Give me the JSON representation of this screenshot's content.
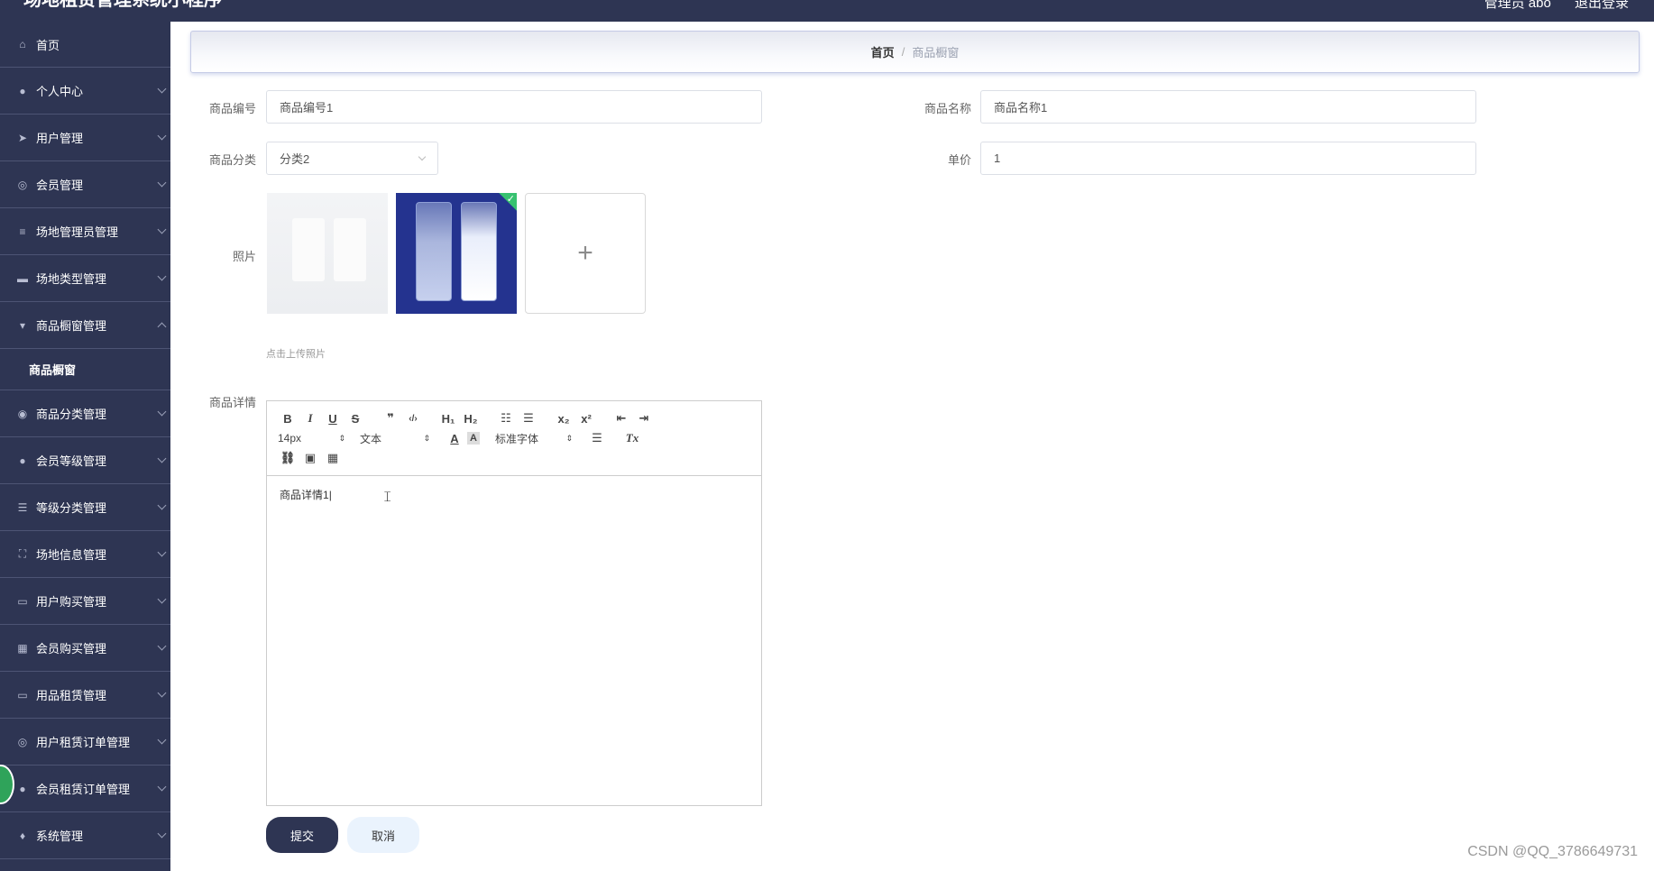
{
  "app": {
    "title": "场地租赁管理系统小程序"
  },
  "top_links": {
    "user": "管理员 abo",
    "logout": "退出登录"
  },
  "sidebar": {
    "items": [
      {
        "label": "首页",
        "icon": "home-icon",
        "chevron": false
      },
      {
        "label": "个人中心",
        "icon": "user-icon",
        "chevron": true
      },
      {
        "label": "用户管理",
        "icon": "send-icon",
        "chevron": true
      },
      {
        "label": "会员管理",
        "icon": "target-icon",
        "chevron": true
      },
      {
        "label": "场地管理员管理",
        "icon": "list-icon",
        "chevron": true
      },
      {
        "label": "场地类型管理",
        "icon": "ticket-icon",
        "chevron": true
      },
      {
        "label": "商品橱窗管理",
        "icon": "cup-icon",
        "chevron": "up"
      },
      {
        "label": "商品分类管理",
        "icon": "compass-icon",
        "chevron": true
      },
      {
        "label": "会员等级管理",
        "icon": "person-icon",
        "chevron": true
      },
      {
        "label": "等级分类管理",
        "icon": "sliders-icon",
        "chevron": true
      },
      {
        "label": "场地信息管理",
        "icon": "fullscreen-icon",
        "chevron": true
      },
      {
        "label": "用户购买管理",
        "icon": "chat-icon",
        "chevron": true
      },
      {
        "label": "会员购买管理",
        "icon": "chart-icon",
        "chevron": true
      },
      {
        "label": "用品租赁管理",
        "icon": "briefcase-icon",
        "chevron": true
      },
      {
        "label": "用户租赁订单管理",
        "icon": "aperture-icon",
        "chevron": true
      },
      {
        "label": "会员租赁订单管理",
        "icon": "location-icon",
        "chevron": true
      },
      {
        "label": "系统管理",
        "icon": "mic-icon",
        "chevron": true
      }
    ],
    "submenu_label": "商品橱窗"
  },
  "breadcrumb": {
    "home": "首页",
    "separator": "/",
    "current": "商品橱窗"
  },
  "form": {
    "code_label": "商品编号",
    "code_value": "商品编号1",
    "name_label": "商品名称",
    "name_value": "商品名称1",
    "category_label": "商品分类",
    "category_value": "分类2",
    "price_label": "单价",
    "price_value": "1",
    "photo_label": "照片",
    "upload_hint": "点击上传照片",
    "upload_plus": "+",
    "detail_label": "商品详情"
  },
  "editor": {
    "size_value": "14px",
    "format_value": "文本",
    "font_value": "标准字体",
    "content": "商品详情1",
    "buttons": {
      "bold": "B",
      "italic": "I",
      "underline": "U",
      "strike": "S",
      "quote": "❞",
      "code": "‹/›",
      "h1": "H₁",
      "h2": "H₂",
      "ol": "☷",
      "ul": "☰",
      "sub": "x₂",
      "sup": "x²",
      "outdent": "⇤",
      "indent": "⇥",
      "color": "A",
      "bg": "A",
      "align": "☰",
      "clean": "Tx",
      "link": "⛓",
      "image": "▣",
      "video": "▦"
    }
  },
  "actions": {
    "submit": "提交",
    "cancel": "取消"
  },
  "watermark": "CSDN @QQ_3786649731",
  "colors": {
    "sidebar_bg": "#2e3553",
    "primary": "#2e3553",
    "cancel_bg": "#eaf3fd",
    "success": "#37c270"
  }
}
